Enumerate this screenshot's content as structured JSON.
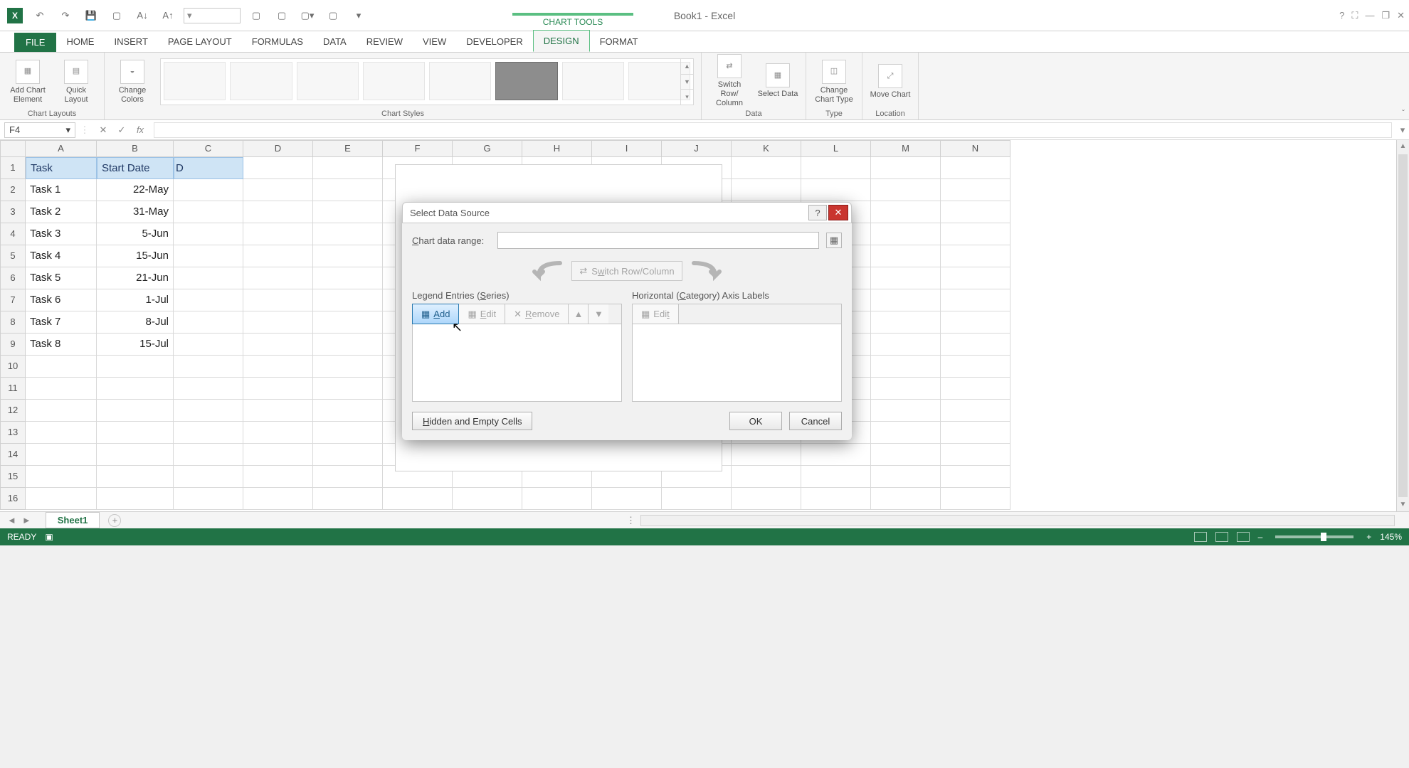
{
  "app": {
    "title": "Book1 - Excel",
    "chart_tools": "CHART TOOLS",
    "zoom": "145%",
    "status": "READY"
  },
  "qat_icons": [
    "undo",
    "redo",
    "save",
    "new",
    "font-shrink",
    "font-grow"
  ],
  "window_controls": [
    "help",
    "fullscreen",
    "minimize",
    "restore",
    "close"
  ],
  "tabs": [
    "HOME",
    "INSERT",
    "PAGE LAYOUT",
    "FORMULAS",
    "DATA",
    "REVIEW",
    "VIEW",
    "DEVELOPER",
    "DESIGN",
    "FORMAT"
  ],
  "active_tab": "DESIGN",
  "file_tab": "FILE",
  "ribbon": {
    "groups": {
      "chart_layouts": "Chart Layouts",
      "chart_styles": "Chart Styles",
      "data": "Data",
      "type": "Type",
      "location": "Location"
    },
    "buttons": {
      "add_chart_element": "Add Chart Element",
      "quick_layout": "Quick Layout",
      "change_colors": "Change Colors",
      "switch_row_col": "Switch Row/ Column",
      "select_data": "Select Data",
      "change_chart_type": "Change Chart Type",
      "move_chart": "Move Chart"
    }
  },
  "formula_bar": {
    "name_box": "F4",
    "fx": "fx",
    "value": ""
  },
  "columns": [
    "A",
    "B",
    "C",
    "D",
    "E",
    "F",
    "G",
    "H",
    "I",
    "J",
    "K",
    "L",
    "M",
    "N"
  ],
  "row_numbers": [
    1,
    2,
    3,
    4,
    5,
    6,
    7,
    8,
    9,
    10,
    11,
    12,
    13,
    14,
    15,
    16
  ],
  "sheet": {
    "headers": {
      "A": "Task",
      "B": "Start Date",
      "C": "D"
    },
    "rows": [
      {
        "A": "Task 1",
        "B": "22-May"
      },
      {
        "A": "Task 2",
        "B": "31-May"
      },
      {
        "A": "Task 3",
        "B": "5-Jun"
      },
      {
        "A": "Task 4",
        "B": "15-Jun"
      },
      {
        "A": "Task 5",
        "B": "21-Jun"
      },
      {
        "A": "Task 6",
        "B": "1-Jul"
      },
      {
        "A": "Task 7",
        "B": "8-Jul"
      },
      {
        "A": "Task 8",
        "B": "15-Jul"
      }
    ]
  },
  "sheet_tabs": {
    "active": "Sheet1"
  },
  "dialog": {
    "title": "Select Data Source",
    "chart_range_label": "Chart data range:",
    "chart_range_value": "",
    "switch_button": "Switch Row/Column",
    "legend_caption": "Legend Entries (Series)",
    "axis_caption": "Horizontal (Category) Axis Labels",
    "legend_buttons": {
      "add": "Add",
      "edit": "Edit",
      "remove": "Remove"
    },
    "axis_buttons": {
      "edit": "Edit"
    },
    "hidden_cells": "Hidden and Empty Cells",
    "ok": "OK",
    "cancel": "Cancel"
  }
}
